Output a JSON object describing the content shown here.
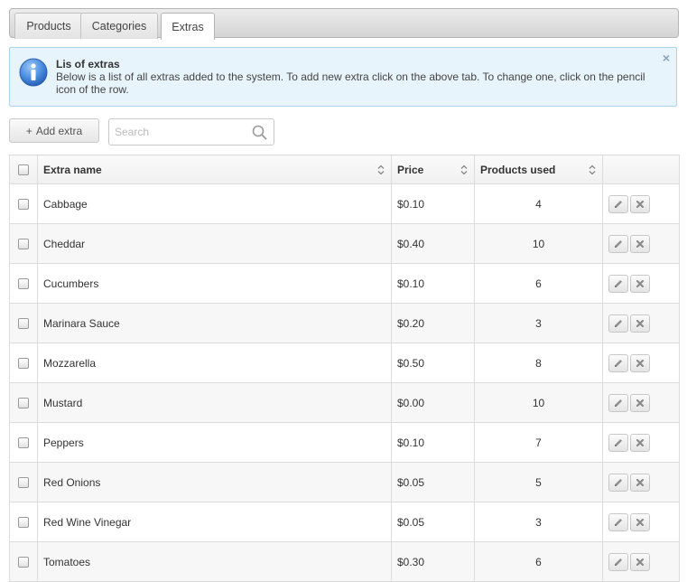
{
  "tabs": [
    {
      "label": "Products",
      "active": false
    },
    {
      "label": "Categories",
      "active": false
    },
    {
      "label": "Extras",
      "active": true
    }
  ],
  "info": {
    "title": "Lis of extras",
    "text": "Below is a list of all extras added to the system. To add new extra click on the above tab. To change one, click on the pencil icon of the row.",
    "close_label": "×",
    "icon": "info-icon"
  },
  "toolbar": {
    "add_prefix": "+",
    "add_label": "Add extra",
    "search_placeholder": "Search",
    "search_value": ""
  },
  "table": {
    "columns": [
      "Extra name",
      "Price",
      "Products used"
    ],
    "rows": [
      {
        "name": "Cabbage",
        "price": "$0.10",
        "used": "4"
      },
      {
        "name": "Cheddar",
        "price": "$0.40",
        "used": "10"
      },
      {
        "name": "Cucumbers",
        "price": "$0.10",
        "used": "6"
      },
      {
        "name": "Marinara Sauce",
        "price": "$0.20",
        "used": "3"
      },
      {
        "name": "Mozzarella",
        "price": "$0.50",
        "used": "8"
      },
      {
        "name": "Mustard",
        "price": "$0.00",
        "used": "10"
      },
      {
        "name": "Peppers",
        "price": "$0.10",
        "used": "7"
      },
      {
        "name": "Red Onions",
        "price": "$0.05",
        "used": "5"
      },
      {
        "name": "Red Wine Vinegar",
        "price": "$0.05",
        "used": "3"
      },
      {
        "name": "Tomatoes",
        "price": "$0.30",
        "used": "6"
      }
    ]
  },
  "colors": {
    "info_bg": "#e8f4fb",
    "info_border": "#a9d4ec",
    "info_icon": "#3d7fd1"
  }
}
